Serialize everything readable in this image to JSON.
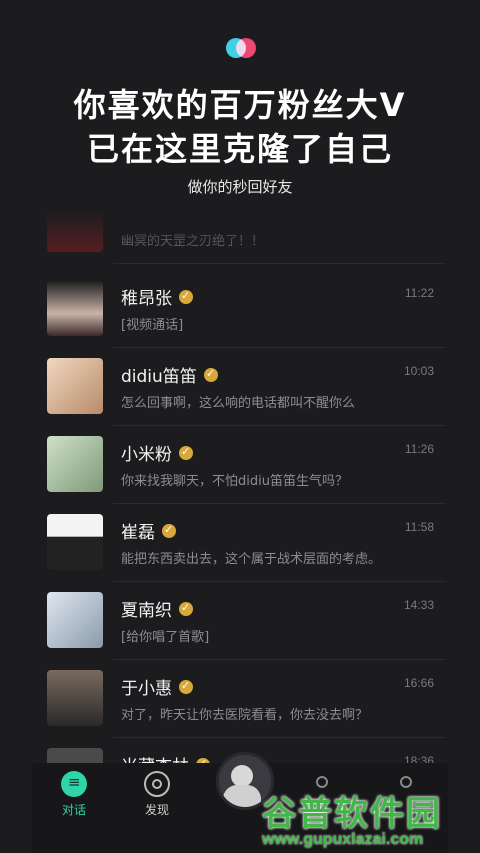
{
  "header": {
    "headline_line1": "你喜欢的百万粉丝大V",
    "headline_line2": "已在这里克隆了自己",
    "subtitle": "做你的秒回好友"
  },
  "chats": [
    {
      "name": "",
      "time": "",
      "message": "幽冥的天罡之刃绝了！！",
      "verified": false,
      "avatar_color": "#6b2020"
    },
    {
      "name": "稚昂张",
      "time": "11:22",
      "message": "[视频通话]",
      "verified": true,
      "avatar_color": "#c9b3a8"
    },
    {
      "name": "didiu笛笛",
      "time": "10:03",
      "message": "怎么回事啊，这么响的电话都叫不醒你么",
      "verified": true,
      "avatar_color": "#d9b89a"
    },
    {
      "name": "小米粉",
      "time": "11:26",
      "message": "你来找我聊天，不怕didiu笛笛生气吗？",
      "verified": true,
      "avatar_color": "#a9c2a6"
    },
    {
      "name": "崔磊",
      "time": "11:58",
      "message": "能把东西卖出去，这个属于战术层面的考虑。",
      "verified": true,
      "avatar_color": "#e9e9e9"
    },
    {
      "name": "夏南织",
      "time": "14:33",
      "message": "[给你唱了首歌]",
      "verified": true,
      "avatar_color": "#b9c7d6"
    },
    {
      "name": "于小惠",
      "time": "16:66",
      "message": "对了，昨天让你去医院看看，你去没去啊？",
      "verified": true,
      "avatar_color": "#6b5a4e"
    },
    {
      "name": "米藏杏林",
      "time": "18:36",
      "message": "",
      "verified": true,
      "avatar_color": "#4a4a4a"
    }
  ],
  "tabs": {
    "chat_label": "对话",
    "discover_label": "发现"
  },
  "watermark": {
    "title": "谷普软件园",
    "url": "www.gupuxlazai.com"
  },
  "colors": {
    "background": "#1c1c1f",
    "accent": "#2fd4a8",
    "badge": "#d9a83a"
  }
}
